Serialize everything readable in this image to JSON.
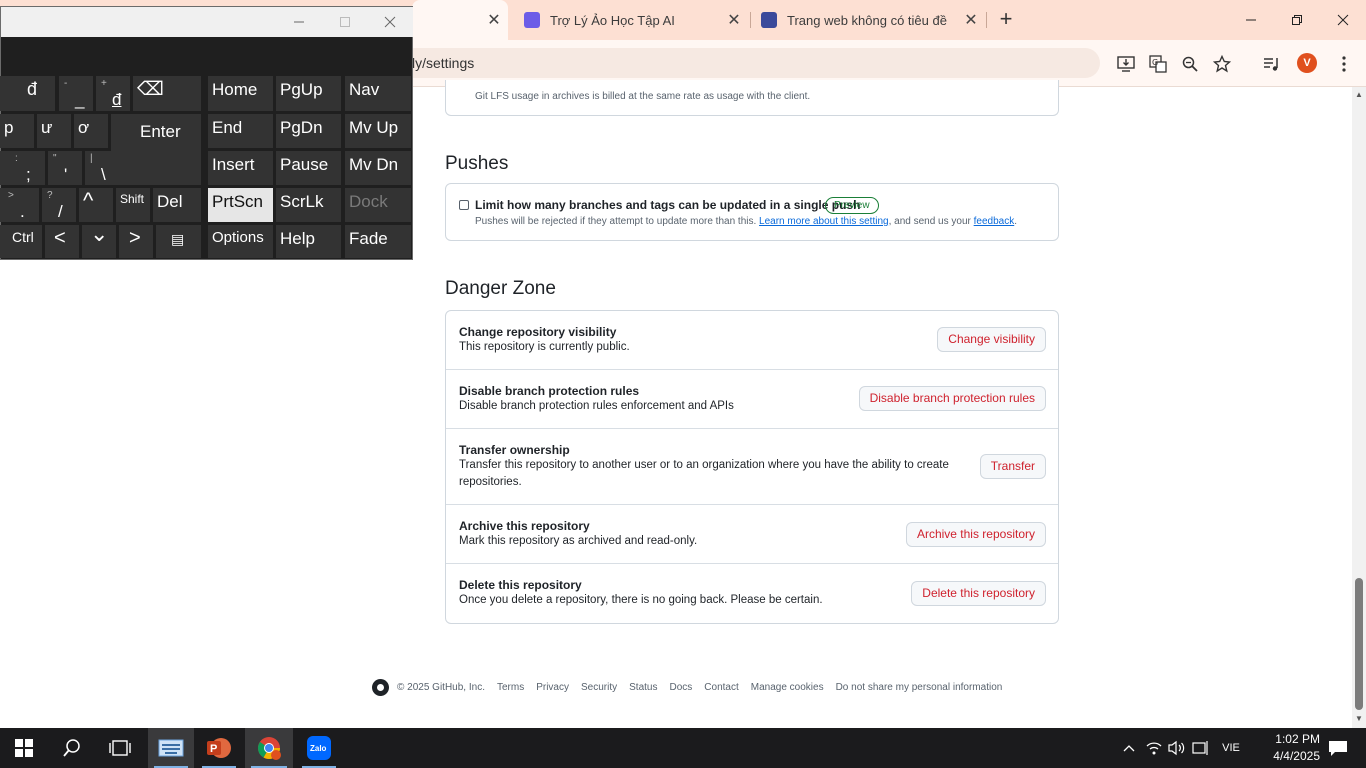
{
  "browser": {
    "tabs": [
      {
        "title": "",
        "active": true
      },
      {
        "title": "Trợ Lý Ảo Học Tập AI",
        "active": false
      },
      {
        "title": "Trang web không có tiêu đề",
        "active": false
      }
    ],
    "new_tab": "+",
    "url": "ly/settings",
    "profile_initial": "V"
  },
  "content": {
    "lfs_note": "Git LFS usage in archives is billed at the same rate as usage with the client.",
    "pushes": {
      "heading": "Pushes",
      "checkbox_label": "Limit how many branches and tags can be updated in a single push",
      "badge": "Preview",
      "desc_before": "Pushes will be rejected if they attempt to update more than this.",
      "learn_more": "Learn more about this setting",
      "desc_middle": ", and send us your",
      "feedback": "feedback",
      "desc_after": "."
    },
    "danger": {
      "heading": "Danger Zone",
      "rows": [
        {
          "title": "Change repository visibility",
          "desc": "This repository is currently public.",
          "button": "Change visibility"
        },
        {
          "title": "Disable branch protection rules",
          "desc": "Disable branch protection rules enforcement and APIs",
          "button": "Disable branch protection rules"
        },
        {
          "title": "Transfer ownership",
          "desc": "Transfer this repository to another user or to an organization where you have the ability to create repositories.",
          "button": "Transfer"
        },
        {
          "title": "Archive this repository",
          "desc": "Mark this repository as archived and read-only.",
          "button": "Archive this repository"
        },
        {
          "title": "Delete this repository",
          "desc": "Once you delete a repository, there is no going back. Please be certain.",
          "button": "Delete this repository"
        }
      ]
    },
    "footer": [
      "© 2025 GitHub, Inc.",
      "Terms",
      "Privacy",
      "Security",
      "Status",
      "Docs",
      "Contact",
      "Manage cookies",
      "Do not share my personal information"
    ]
  },
  "keyboard": {
    "keys": {
      "d_stroke": "đ",
      "minus_shift": "-",
      "minus": "_",
      "plus_shift": "+",
      "plus": "đ",
      "backspace": "⌫",
      "home": "Home",
      "pgup": "PgUp",
      "nav": "Nav",
      "p": "p",
      "u_horn": "ư",
      "o_horn": "ơ",
      "enter": "Enter",
      "end": "End",
      "pgdn": "PgDn",
      "mvup": "Mv Up",
      "colon_shift": ":",
      "semicolon": ";",
      "quote_shift": "\"",
      "quote": "'",
      "pipe_shift": "|",
      "backslash": "\\",
      "insert": "Insert",
      "pause": "Pause",
      "mvdn": "Mv Dn",
      "gt_shift": ">",
      "period": ".",
      "q_shift": "?",
      "slash": "/",
      "up": "^",
      "shift": "Shift",
      "del": "Del",
      "prtscn": "PrtScn",
      "scrlk": "ScrLk",
      "dock": "Dock",
      "ctrl": "Ctrl",
      "left": "<",
      "down": "⌄",
      "right": ">",
      "menu": "▤",
      "options": "Options",
      "help": "Help",
      "fade": "Fade"
    }
  },
  "taskbar": {
    "language": "VIE",
    "time": "1:02 PM",
    "date": "4/4/2025",
    "notifications": "1"
  },
  "colors": {
    "danger": "#cf222e",
    "link": "#0969da",
    "badge": "#1a7f37",
    "tabstrip": "#fde0d3"
  }
}
